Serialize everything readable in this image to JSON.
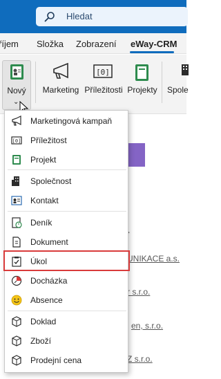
{
  "search": {
    "placeholder": "Hledat",
    "icon": "search-icon"
  },
  "tabs": [
    {
      "label": "říjem"
    },
    {
      "label": "Složka"
    },
    {
      "label": "Zobrazení"
    },
    {
      "label": "eWay-CRM",
      "active": true
    }
  ],
  "ribbon": {
    "new_button": {
      "label": "Nový"
    },
    "buttons": [
      {
        "label": "Marketing",
        "icon": "megaphone-icon"
      },
      {
        "label": "Příležitosti",
        "icon": "opportunity-icon"
      },
      {
        "label": "Projekty",
        "icon": "project-icon"
      },
      {
        "label": "Spole",
        "icon": "company-icon"
      }
    ]
  },
  "menu": {
    "items": [
      {
        "label": "Marketingová kampaň",
        "icon": "megaphone-icon"
      },
      {
        "label": "Příležitost",
        "icon": "opportunity-icon"
      },
      {
        "label": "Projekt",
        "icon": "project-icon"
      },
      {
        "label": "Společnost",
        "icon": "company-icon"
      },
      {
        "label": "Kontakt",
        "icon": "contact-card-icon"
      },
      {
        "label": "Deník",
        "icon": "journal-icon"
      },
      {
        "label": "Dokument",
        "icon": "document-icon"
      },
      {
        "label": "Úkol",
        "icon": "task-icon",
        "highlighted": true
      },
      {
        "label": "Docházka",
        "icon": "attendance-icon"
      },
      {
        "label": "Absence",
        "icon": "absence-smiley-icon"
      },
      {
        "label": "Doklad",
        "icon": "receipt-cube-icon"
      },
      {
        "label": "Zboží",
        "icon": "goods-cube-icon"
      },
      {
        "label": "Prodejní cena",
        "icon": "price-cube-icon"
      }
    ]
  },
  "background": {
    "rows": [
      "UNIKACE a.s.",
      "r s.r.o.",
      "en, s.r.o.",
      "Z s.r.o."
    ]
  },
  "colors": {
    "accent": "#0f6cbd",
    "highlight": "#d93a3a",
    "project_green": "#2e8b4e",
    "purple": "#8464c5"
  }
}
